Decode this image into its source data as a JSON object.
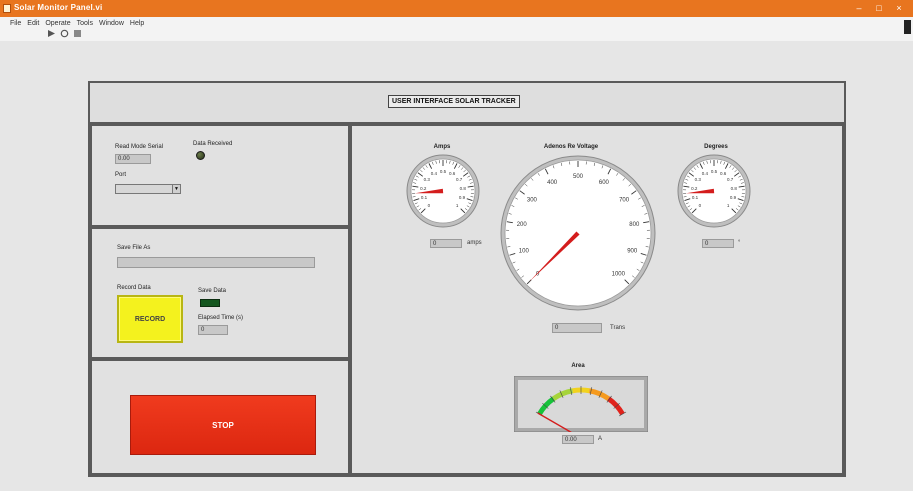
{
  "window": {
    "title": "Solar Monitor Panel.vi"
  },
  "menu": {
    "items": [
      "File",
      "Edit",
      "Operate",
      "Tools",
      "Window",
      "Help"
    ]
  },
  "header": {
    "title": "USER INTERFACE SOLAR TRACKER"
  },
  "serial": {
    "read_mode_label": "Read Mode Serial",
    "read_mode_value": "0.00",
    "port_label": "Port",
    "port_value": "",
    "data_received_label": "Data Received"
  },
  "record": {
    "save_file_label": "Save File As",
    "save_file_value": "",
    "record_data_label": "Record Data",
    "record_button": "RECORD",
    "save_data_label": "Save Data",
    "elapsed_time_label": "Elapsed Time (s)",
    "elapsed_time_value": "0"
  },
  "stop": {
    "label": "STOP"
  },
  "gauges": {
    "amps": {
      "title": "Amps",
      "value": "0",
      "unit": "amps",
      "max": 1,
      "reading": 0.15
    },
    "voltage": {
      "title": "Adenos Re Voltage",
      "value": "0",
      "unit": "Trans",
      "max": 1000,
      "reading": 0.0
    },
    "degrees": {
      "title": "Degrees",
      "value": "0",
      "unit": "°",
      "max": 1,
      "reading": 0.15
    },
    "area": {
      "title": "Area",
      "value": "0.00",
      "unit": "A"
    }
  },
  "colors": {
    "titlebar": "#e8751f",
    "record": "#f4f21e",
    "stop": "#e32f16",
    "needle": "#d41d1d"
  }
}
